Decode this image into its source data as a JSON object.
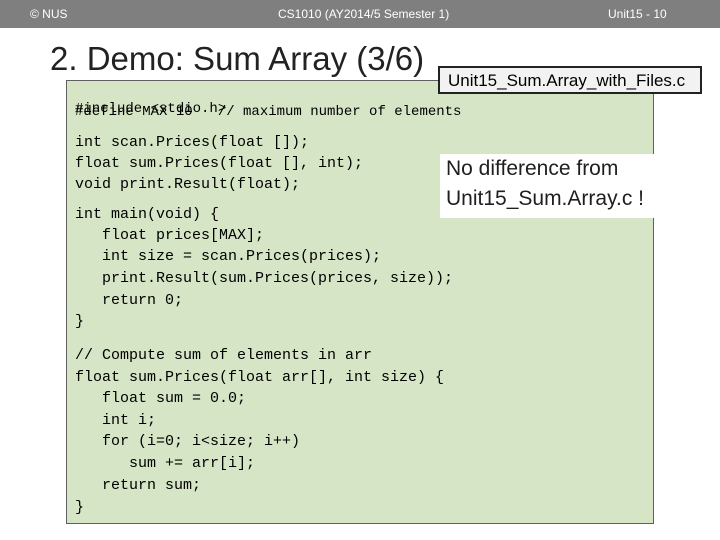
{
  "header": {
    "left": "© NUS",
    "center": "CS1010 (AY2014/5 Semester 1)",
    "right": "Unit15 - 10"
  },
  "slide": {
    "title": "2. Demo: Sum Array (3/6)",
    "filename": "Unit15_Sum.Array_with_Files.c",
    "note_line1": "No difference from",
    "note_line2": "Unit15_Sum.Array.c !"
  },
  "code": {
    "lines": [
      "#include <stdio.h>",
      "#define MAX 10   // maximum number of elements",
      "int scan.Prices(float []);",
      "float sum.Prices(float [], int);",
      "void print.Result(float);",
      "int main(void) {",
      "   float prices[MAX];",
      "   int size = scan.Prices(prices);",
      "   print.Result(sum.Prices(prices, size));",
      "   return 0;",
      "}",
      "// Compute sum of elements in arr",
      "float sum.Prices(float arr[], int size) {",
      "   float sum = 0.0;",
      "   int i;",
      "   for (i=0; i<size; i++)",
      "      sum += arr[i];",
      "   return sum;",
      "}"
    ]
  }
}
